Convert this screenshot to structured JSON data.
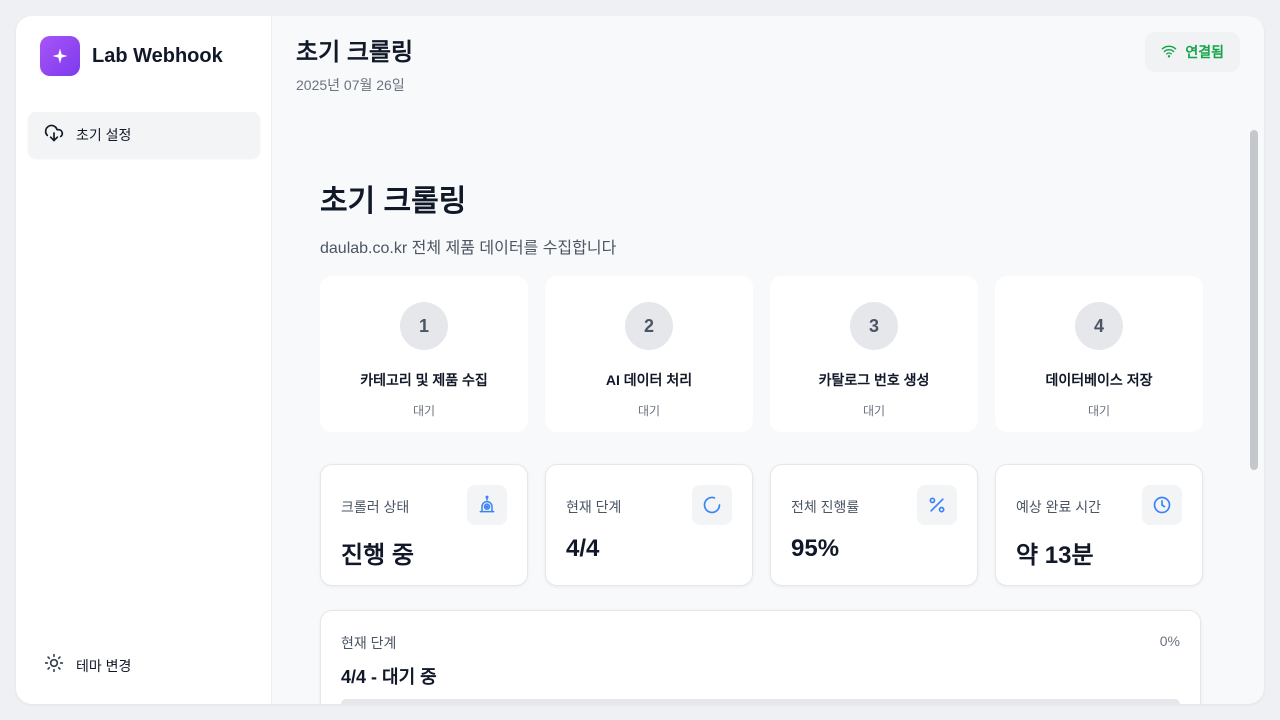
{
  "app": {
    "name": "Lab Webhook"
  },
  "sidebar": {
    "items": [
      {
        "label": "초기 설정",
        "icon": "cloud-download-icon"
      }
    ],
    "theme_toggle": {
      "label": "테마 변경",
      "icon": "sun-icon"
    }
  },
  "header": {
    "title": "초기 크롤링",
    "date": "2025년 07월 26일",
    "status": {
      "label": "연결됨",
      "icon": "wifi-icon",
      "color": "#16a34a"
    }
  },
  "content": {
    "title": "초기 크롤링",
    "subtitle": "daulab.co.kr 전체 제품 데이터를 수집합니다",
    "steps": [
      {
        "number": "1",
        "name": "카테고리 및 제품 수집",
        "status": "대기"
      },
      {
        "number": "2",
        "name": "AI 데이터 처리",
        "status": "대기"
      },
      {
        "number": "3",
        "name": "카탈로그 번호 생성",
        "status": "대기"
      },
      {
        "number": "4",
        "name": "데이터베이스 저장",
        "status": "대기"
      }
    ],
    "stats": [
      {
        "label": "크롤러 상태",
        "value": "진행 중",
        "icon": "robot-icon"
      },
      {
        "label": "현재 단계",
        "value": "4/4",
        "icon": "spinner-icon"
      },
      {
        "label": "전체 진행률",
        "value": "95%",
        "icon": "percent-icon"
      },
      {
        "label": "예상 완료 시간",
        "value": "약 13분",
        "icon": "clock-icon"
      }
    ],
    "progress": {
      "label": "현재 단계",
      "percent_text": "0%",
      "percent": 0,
      "stage": "4/4 - 대기 중"
    }
  },
  "colors": {
    "accent": "#7c3aed",
    "icon_blue": "#3b82f6",
    "success": "#16a34a"
  }
}
